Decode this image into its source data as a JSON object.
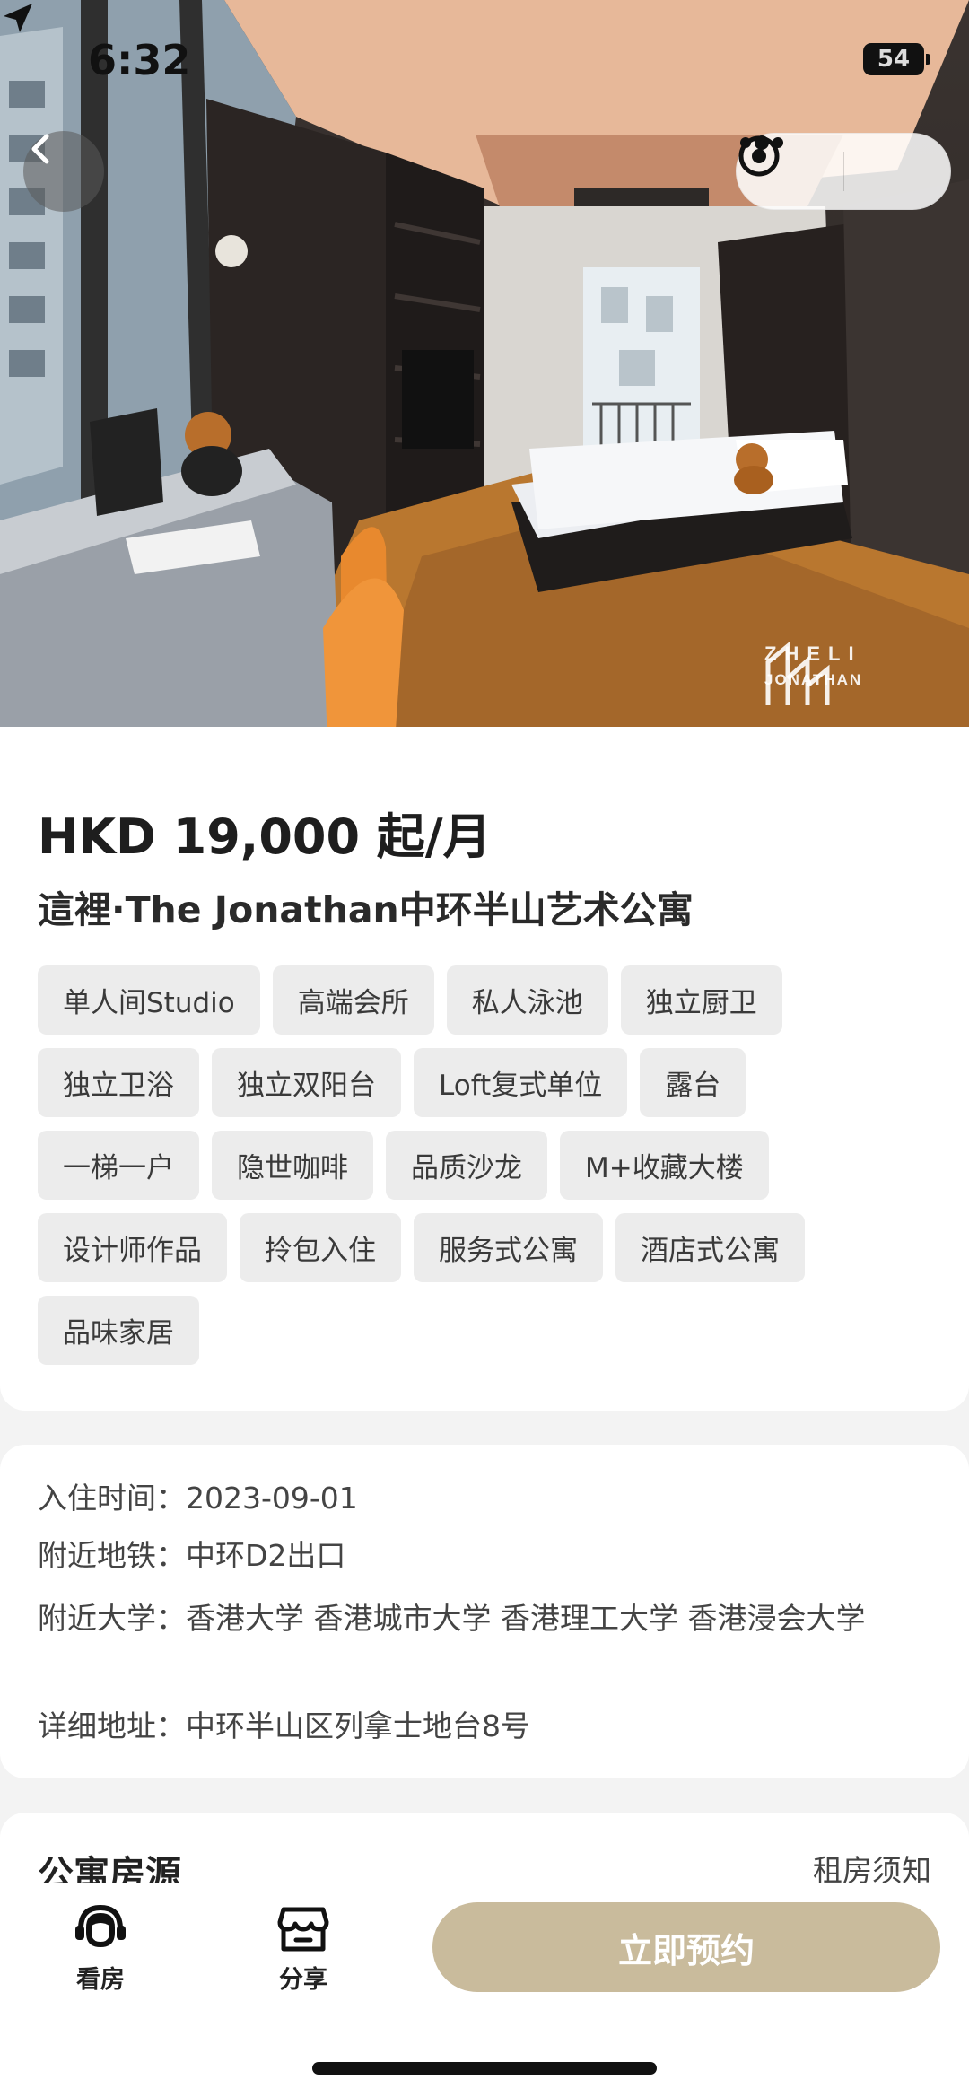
{
  "status_bar": {
    "time": "6:32",
    "battery": "54"
  },
  "hero": {
    "watermark_line1": "ZHELI",
    "watermark_line2": "JONATHAN"
  },
  "listing": {
    "price": "HKD 19,000 起/月",
    "title": "這裡·The Jonathan中环半山艺术公寓",
    "tag_rows": [
      [
        "单人间Studio",
        "高端会所",
        "私人泳池",
        "独立厨卫"
      ],
      [
        "独立卫浴",
        "独立双阳台",
        "Loft复式单位",
        "露台"
      ],
      [
        "一梯一户",
        "隐世咖啡",
        "品质沙龙",
        "M+收藏大楼"
      ],
      [
        "设计师作品",
        "拎包入住",
        "服务式公寓",
        "酒店式公寓"
      ],
      [
        "品味家居"
      ]
    ]
  },
  "details": [
    "入住时间：2023-09-01",
    "附近地铁：中环D2出口",
    "附近大学：香港大学 香港城市大学 香港理工大学 香港浸会大学",
    "详细地址：中环半山区列拿士地台8号"
  ],
  "section": {
    "title": "公寓房源",
    "rent_notice": "租房须知"
  },
  "bottom_bar": {
    "view_label": "看房",
    "share_label": "分享",
    "book_label": "立即预约"
  },
  "colors": {
    "accent": "#c9bb9c",
    "tag_bg": "#ececec"
  },
  "icons": [
    "back-arrow-icon",
    "more-dots-icon",
    "target-icon",
    "headset-agent-icon",
    "store-share-icon",
    "location-arrow-icon",
    "signal-icon",
    "wifi-icon"
  ]
}
